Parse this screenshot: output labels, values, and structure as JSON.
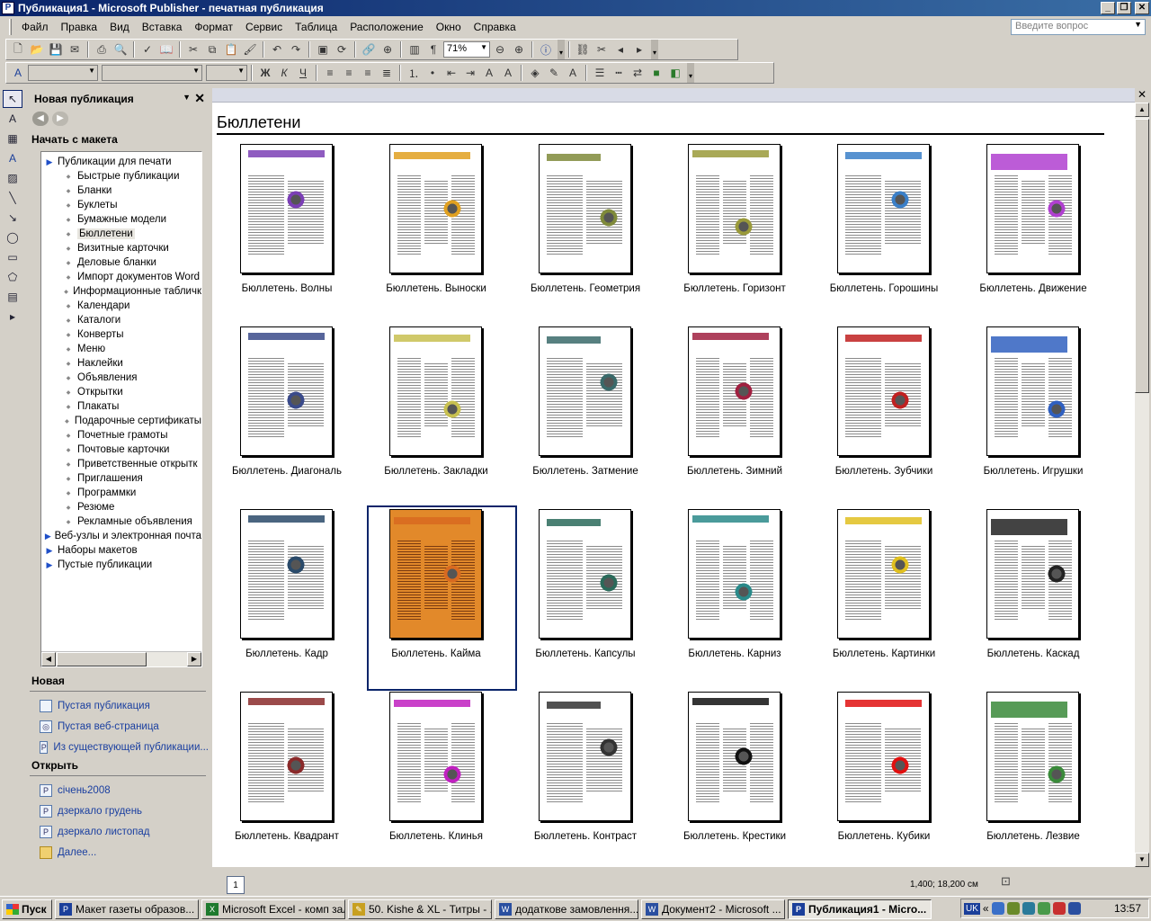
{
  "window": {
    "title": "Публикация1 - Microsoft Publisher - печатная публикация"
  },
  "menu": [
    "Файл",
    "Правка",
    "Вид",
    "Вставка",
    "Формат",
    "Сервис",
    "Таблица",
    "Расположение",
    "Окно",
    "Справка"
  ],
  "help_placeholder": "Введите вопрос",
  "toolbar": {
    "zoom": "71%"
  },
  "taskpane": {
    "title": "Новая публикация",
    "start_from": "Начать с макета",
    "tree": [
      {
        "label": "Публикации для печати",
        "level": 0
      },
      {
        "label": "Быстрые публикации",
        "level": 1
      },
      {
        "label": "Бланки",
        "level": 1
      },
      {
        "label": "Буклеты",
        "level": 1
      },
      {
        "label": "Бумажные модели",
        "level": 1
      },
      {
        "label": "Бюллетени",
        "level": 1,
        "selected": true
      },
      {
        "label": "Визитные карточки",
        "level": 1
      },
      {
        "label": "Деловые бланки",
        "level": 1
      },
      {
        "label": "Импорт документов Word",
        "level": 1
      },
      {
        "label": "Информационные табличк",
        "level": 1
      },
      {
        "label": "Календари",
        "level": 1
      },
      {
        "label": "Каталоги",
        "level": 1
      },
      {
        "label": "Конверты",
        "level": 1
      },
      {
        "label": "Меню",
        "level": 1
      },
      {
        "label": "Наклейки",
        "level": 1
      },
      {
        "label": "Объявления",
        "level": 1
      },
      {
        "label": "Открытки",
        "level": 1
      },
      {
        "label": "Плакаты",
        "level": 1
      },
      {
        "label": "Подарочные сертификаты",
        "level": 1
      },
      {
        "label": "Почетные грамоты",
        "level": 1
      },
      {
        "label": "Почтовые карточки",
        "level": 1
      },
      {
        "label": "Приветственные открытк",
        "level": 1
      },
      {
        "label": "Приглашения",
        "level": 1
      },
      {
        "label": "Программки",
        "level": 1
      },
      {
        "label": "Резюме",
        "level": 1
      },
      {
        "label": "Рекламные объявления",
        "level": 1
      },
      {
        "label": "Веб-узлы и электронная почта",
        "level": 0
      },
      {
        "label": "Наборы макетов",
        "level": 0
      },
      {
        "label": "Пустые публикации",
        "level": 0
      }
    ],
    "new_title": "Новая",
    "new_links": [
      "Пустая публикация",
      "Пустая веб-страница",
      "Из существующей публикации..."
    ],
    "open_title": "Открыть",
    "open_links": [
      "січень2008",
      "дзеркало грудень",
      "дзеркало листопад",
      "Далее..."
    ]
  },
  "gallery": {
    "title": "Бюллетени",
    "items": [
      {
        "label": "Бюллетень. Волны",
        "accent": "#7b3fb5"
      },
      {
        "label": "Бюллетень. Выноски",
        "accent": "#e0a020"
      },
      {
        "label": "Бюллетень. Геометрия",
        "accent": "#7f8a3a"
      },
      {
        "label": "Бюллетень. Горизонт",
        "accent": "#9a9a3a"
      },
      {
        "label": "Бюллетень. Горошины",
        "accent": "#3a7fc8"
      },
      {
        "label": "Бюллетень. Движение",
        "accent": "#b040d0"
      },
      {
        "label": "Бюллетень. Диагональ",
        "accent": "#3a4a8a"
      },
      {
        "label": "Бюллетень. Закладки",
        "accent": "#c8c050"
      },
      {
        "label": "Бюллетень. Затмение",
        "accent": "#3a6a6a"
      },
      {
        "label": "Бюллетень. Зимний",
        "accent": "#a02040"
      },
      {
        "label": "Бюллетень. Зубчики",
        "accent": "#c02020"
      },
      {
        "label": "Бюллетень. Игрушки",
        "accent": "#3060c0"
      },
      {
        "label": "Бюллетень. Кадр",
        "accent": "#2a4a6a"
      },
      {
        "label": "Бюллетень. Кайма",
        "accent": "#d86a20"
      },
      {
        "label": "Бюллетень. Капсулы",
        "accent": "#2a6a5a"
      },
      {
        "label": "Бюллетень. Карниз",
        "accent": "#2a8a8a"
      },
      {
        "label": "Бюллетень. Картинки",
        "accent": "#e0c020"
      },
      {
        "label": "Бюллетень. Каскад",
        "accent": "#222222"
      },
      {
        "label": "Бюллетень. Квадрант",
        "accent": "#8a2a2a"
      },
      {
        "label": "Бюллетень. Клинья",
        "accent": "#c020c0"
      },
      {
        "label": "Бюллетень. Контраст",
        "accent": "#333333"
      },
      {
        "label": "Бюллетень. Крестики",
        "accent": "#111111"
      },
      {
        "label": "Бюллетень. Кубики",
        "accent": "#e01010"
      },
      {
        "label": "Бюллетень. Лезвие",
        "accent": "#3a8a3a"
      }
    ],
    "selected_index": 13
  },
  "status": {
    "page": "1",
    "coords": "1,400; 18,200 см"
  },
  "taskbar": {
    "start": "Пуск",
    "buttons": [
      "Макет газеты образов...",
      "Microsoft Excel - комп зал",
      "50. Kishe & XL - Титры - ...",
      "додаткове замовлення...",
      "Документ2 - Microsoft ...",
      "Публикация1 - Micro..."
    ],
    "lang": "UK",
    "clock": "13:57"
  }
}
